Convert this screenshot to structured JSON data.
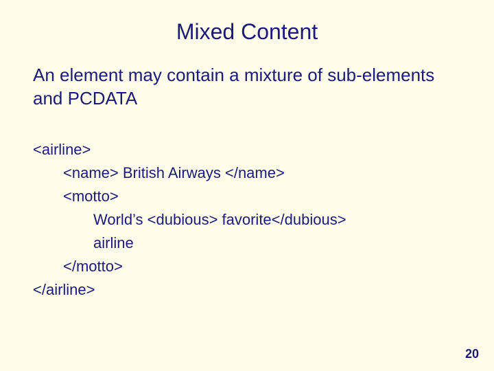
{
  "title": "Mixed Content",
  "subtitle": "An element may contain a mixture of sub-elements and PCDATA",
  "code": {
    "l1": "<airline>",
    "l2": "<name> British Airways </name>",
    "l3": "<motto>",
    "l4": "World’s <dubious> favorite</dubious>",
    "l5": "airline",
    "l6": "</motto>",
    "l7": "</airline>"
  },
  "page_number": "20"
}
